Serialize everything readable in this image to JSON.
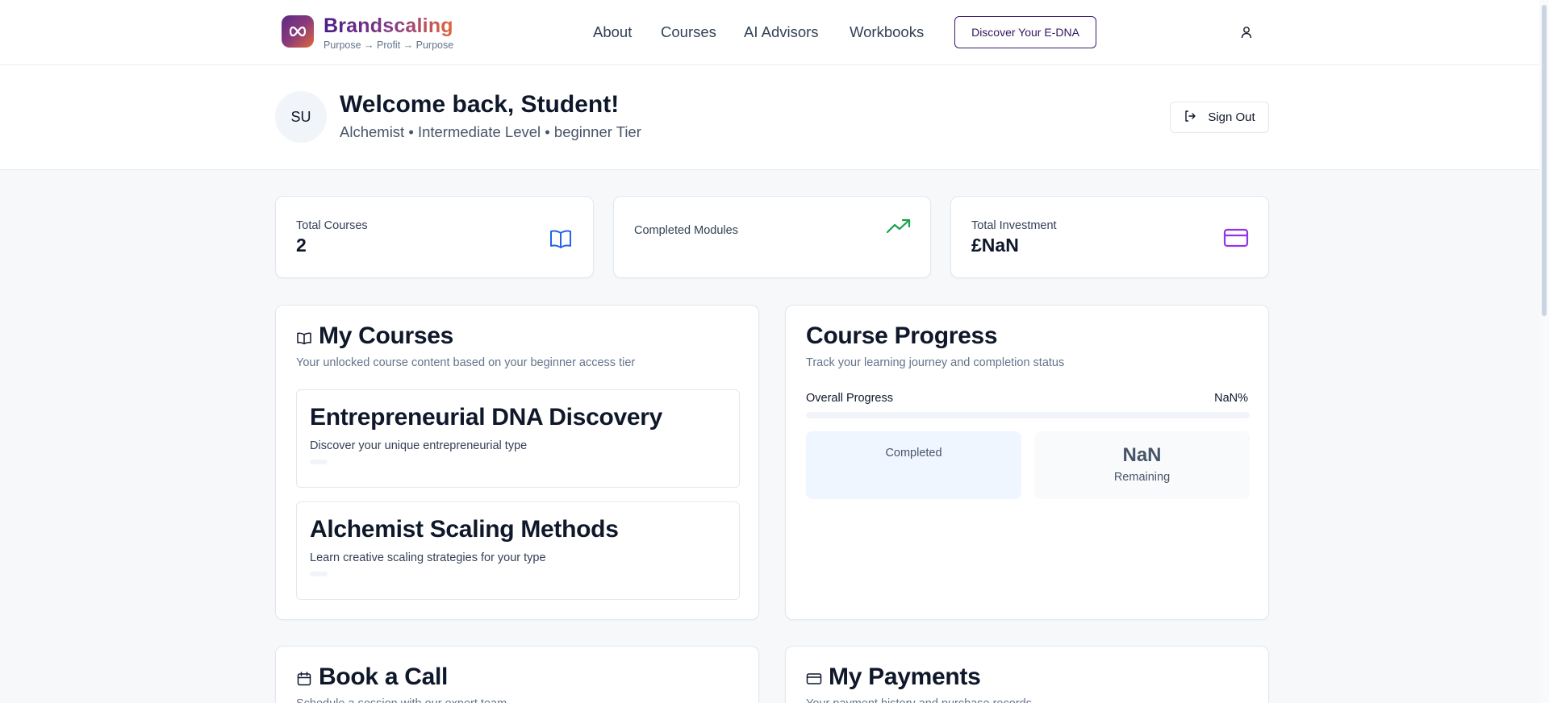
{
  "header": {
    "brand_name": "Brandscaling",
    "brand_tagline": "Purpose → Profit → Purpose",
    "nav": [
      "About",
      "Courses",
      "AI Advisors",
      "Workbooks"
    ],
    "cta_label": "Discover Your E-DNA",
    "icons": {
      "logo": "infinity-icon",
      "user": "user-icon"
    }
  },
  "welcome": {
    "avatar_initials": "SU",
    "title": "Welcome back, Student!",
    "subtitle": "Alchemist • Intermediate Level • beginner Tier",
    "signout_label": "Sign Out"
  },
  "stats": [
    {
      "label": "Total Courses",
      "value": "2",
      "icon": "book-open-icon",
      "color": "#2563eb"
    },
    {
      "label": "Completed Modules",
      "value": "",
      "icon": "trending-up-icon",
      "color": "#16a34a"
    },
    {
      "label": "Total Investment",
      "value": "£NaN",
      "icon": "credit-card-icon",
      "color": "#9333ea"
    }
  ],
  "my_courses": {
    "title": "My Courses",
    "description": "Your unlocked course content based on your beginner access tier",
    "items": [
      {
        "title": "Entrepreneurial DNA Discovery",
        "description": "Discover your unique entrepreneurial type"
      },
      {
        "title": "Alchemist Scaling Methods",
        "description": "Learn creative scaling strategies for your type"
      }
    ]
  },
  "course_progress": {
    "title": "Course Progress",
    "description": "Track your learning journey and completion status",
    "overall_label": "Overall Progress",
    "overall_value": "NaN%",
    "overall_fraction": 0,
    "completed_label": "Completed",
    "remaining_value": "NaN",
    "remaining_label": "Remaining"
  },
  "book_call": {
    "title": "Book a Call",
    "description": "Schedule a session with our expert team"
  },
  "payments": {
    "title": "My Payments",
    "description": "Your payment history and purchase records"
  },
  "colors": {
    "accent_purple": "#3b1d6e",
    "brand_gradient_start": "#4b1d83",
    "brand_gradient_end": "#e2673a",
    "completed_box_bg": "#eff6ff",
    "remaining_box_bg": "#f8fafc"
  }
}
